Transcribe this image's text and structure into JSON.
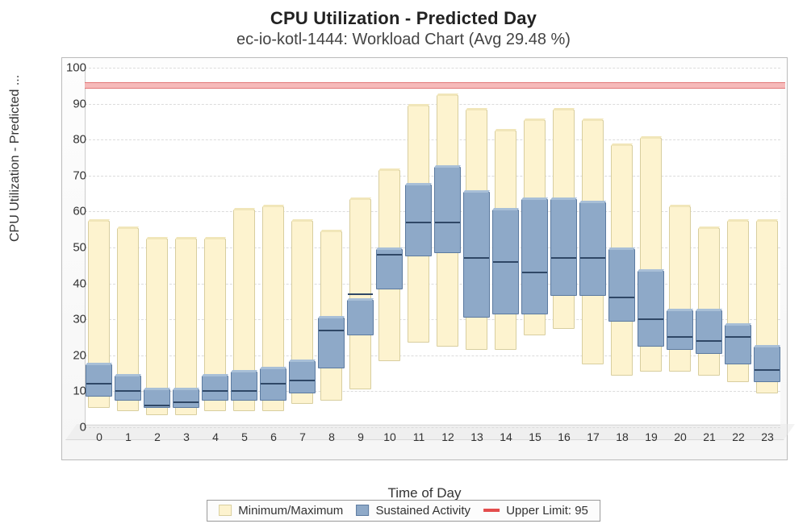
{
  "title": "CPU Utilization - Predicted Day",
  "subtitle": "ec-io-kotl-1444: Workload Chart (Avg 29.48 %)",
  "ylabel": "CPU Utilization - Predicted ...",
  "xlabel": "Time of Day",
  "legend": {
    "minmax": "Minimum/Maximum",
    "sustained": "Sustained Activity",
    "limit": "Upper Limit: 95"
  },
  "chart_data": {
    "type": "bar",
    "title": "CPU Utilization - Predicted Day",
    "subtitle": "ec-io-kotl-1444: Workload Chart (Avg 29.48 %)",
    "xlabel": "Time of Day",
    "ylabel": "CPU Utilization - Predicted ...",
    "ylim": [
      0,
      100
    ],
    "yticks": [
      0,
      10,
      20,
      30,
      40,
      50,
      60,
      70,
      80,
      90,
      100
    ],
    "upper_limit": 95,
    "categories": [
      "0",
      "1",
      "2",
      "3",
      "4",
      "5",
      "6",
      "7",
      "8",
      "9",
      "10",
      "11",
      "12",
      "13",
      "14",
      "15",
      "16",
      "17",
      "18",
      "19",
      "20",
      "21",
      "22",
      "23"
    ],
    "series": [
      {
        "name": "Minimum/Maximum",
        "kind": "range",
        "low": [
          5,
          4,
          3,
          3,
          4,
          4,
          4,
          6,
          7,
          10,
          18,
          23,
          22,
          21,
          21,
          25,
          27,
          17,
          14,
          15,
          15,
          14,
          12,
          9
        ],
        "high": [
          57,
          55,
          52,
          52,
          52,
          60,
          61,
          57,
          54,
          63,
          71,
          89,
          92,
          88,
          82,
          85,
          88,
          85,
          78,
          80,
          61,
          55,
          57,
          57
        ]
      },
      {
        "name": "Sustained Activity",
        "kind": "box",
        "low": [
          8,
          7,
          5,
          5,
          7,
          7,
          7,
          9,
          16,
          25,
          38,
          47,
          48,
          30,
          31,
          31,
          36,
          36,
          29,
          22,
          21,
          20,
          17,
          12
        ],
        "mid": [
          12,
          10,
          6,
          7,
          10,
          10,
          12,
          13,
          27,
          37,
          48,
          57,
          57,
          47,
          46,
          43,
          47,
          47,
          36,
          30,
          25,
          24,
          25,
          16
        ],
        "high": [
          17,
          14,
          10,
          10,
          14,
          15,
          16,
          18,
          30,
          35,
          49,
          67,
          72,
          65,
          60,
          63,
          63,
          62,
          49,
          43,
          32,
          32,
          28,
          22
        ]
      }
    ],
    "annotations": [
      {
        "type": "hline",
        "y": 95,
        "label": "Upper Limit: 95"
      }
    ]
  }
}
